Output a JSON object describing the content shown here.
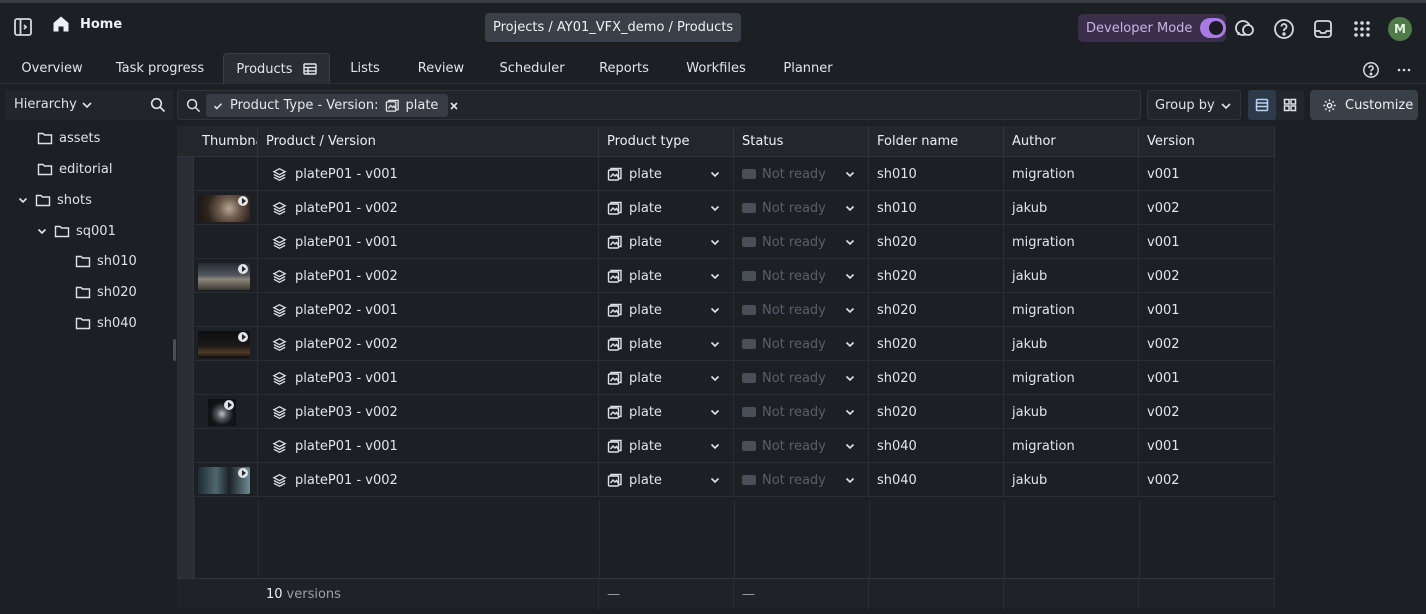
{
  "topbar": {
    "home_label": "Home",
    "breadcrumb": "Projects / AY01_VFX_demo / Products",
    "developer_mode_label": "Developer Mode",
    "developer_mode_on": true,
    "avatar_initial": "M",
    "colors": {
      "accent": "#a77be3",
      "avatar": "#4f7a4a"
    }
  },
  "tabs": [
    {
      "label": "Overview"
    },
    {
      "label": "Task progress"
    },
    {
      "label": "Products",
      "active": true
    },
    {
      "label": "Lists"
    },
    {
      "label": "Review"
    },
    {
      "label": "Scheduler"
    },
    {
      "label": "Reports"
    },
    {
      "label": "Workfiles"
    },
    {
      "label": "Planner"
    }
  ],
  "hierarchy": {
    "label": "Hierarchy",
    "items": [
      {
        "label": "assets",
        "depth": 0,
        "expandable": false
      },
      {
        "label": "editorial",
        "depth": 0,
        "expandable": false
      },
      {
        "label": "shots",
        "depth": 0,
        "expandable": true,
        "expanded": true
      },
      {
        "label": "sq001",
        "depth": 1,
        "expandable": true,
        "expanded": true
      },
      {
        "label": "sh010",
        "depth": 2,
        "expandable": false
      },
      {
        "label": "sh020",
        "depth": 2,
        "expandable": false
      },
      {
        "label": "sh040",
        "depth": 2,
        "expandable": false
      }
    ]
  },
  "filter": {
    "chip_label": "Product Type - Version:",
    "chip_value": "plate"
  },
  "toolbar": {
    "group_by_label": "Group by",
    "customize_label": "Customize"
  },
  "table": {
    "columns": [
      "Thumbnail",
      "Product / Version",
      "Product type",
      "Status",
      "Folder name",
      "Author",
      "Version"
    ],
    "rows": [
      {
        "thumb": null,
        "name": "plateP01 - v001",
        "type": "plate",
        "status": "Not ready",
        "folder": "sh010",
        "author": "migration",
        "version": "v001"
      },
      {
        "thumb": "warm",
        "name": "plateP01 - v002",
        "type": "plate",
        "status": "Not ready",
        "folder": "sh010",
        "author": "jakub",
        "version": "v002"
      },
      {
        "thumb": null,
        "name": "plateP01 - v001",
        "type": "plate",
        "status": "Not ready",
        "folder": "sh020",
        "author": "migration",
        "version": "v001"
      },
      {
        "thumb": "road",
        "name": "plateP01 - v002",
        "type": "plate",
        "status": "Not ready",
        "folder": "sh020",
        "author": "jakub",
        "version": "v002"
      },
      {
        "thumb": null,
        "name": "plateP02 - v001",
        "type": "plate",
        "status": "Not ready",
        "folder": "sh020",
        "author": "migration",
        "version": "v001"
      },
      {
        "thumb": "dark",
        "name": "plateP02 - v002",
        "type": "plate",
        "status": "Not ready",
        "folder": "sh020",
        "author": "jakub",
        "version": "v002"
      },
      {
        "thumb": null,
        "name": "plateP03 - v001",
        "type": "plate",
        "status": "Not ready",
        "folder": "sh020",
        "author": "migration",
        "version": "v001"
      },
      {
        "thumb": "small",
        "name": "plateP03 - v002",
        "type": "plate",
        "status": "Not ready",
        "folder": "sh020",
        "author": "jakub",
        "version": "v002"
      },
      {
        "thumb": null,
        "name": "plateP01 - v001",
        "type": "plate",
        "status": "Not ready",
        "folder": "sh040",
        "author": "migration",
        "version": "v001"
      },
      {
        "thumb": "blue",
        "name": "plateP01 - v002",
        "type": "plate",
        "status": "Not ready",
        "folder": "sh040",
        "author": "jakub",
        "version": "v002"
      }
    ],
    "footer": {
      "count": "10",
      "count_label": "versions",
      "type_dash": "—",
      "status_dash": "—"
    }
  }
}
